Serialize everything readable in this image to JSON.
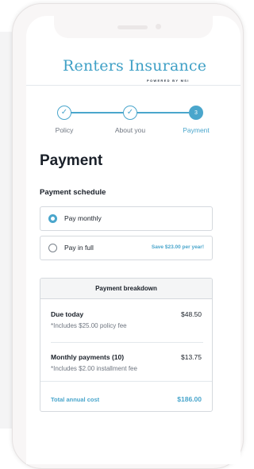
{
  "brand": {
    "title": "Renters Insurance",
    "subtitle": "POWERED BY MSI"
  },
  "steps": [
    {
      "label": "Policy",
      "state": "done",
      "icon": "check-icon"
    },
    {
      "label": "About you",
      "state": "done",
      "icon": "check-icon"
    },
    {
      "label": "Payment",
      "state": "active",
      "number": "3"
    }
  ],
  "page": {
    "title": "Payment",
    "section_label": "Payment schedule"
  },
  "options": [
    {
      "label": "Pay monthly",
      "selected": true
    },
    {
      "label": "Pay in full",
      "selected": false,
      "promo": "Save $23.00 per year!"
    }
  ],
  "breakdown": {
    "header": "Payment breakdown",
    "due_today": {
      "title": "Due today",
      "amount": "$48.50",
      "note": "*Includes $25.00 policy fee"
    },
    "monthly": {
      "title": "Monthly payments (10)",
      "amount": "$13.75",
      "note": "*Includes $2.00 installment fee"
    },
    "total": {
      "label": "Total annual cost",
      "amount": "$186.00"
    }
  },
  "colors": {
    "accent": "#4aa6cc",
    "text": "#1a2029",
    "muted": "#6f7680"
  }
}
